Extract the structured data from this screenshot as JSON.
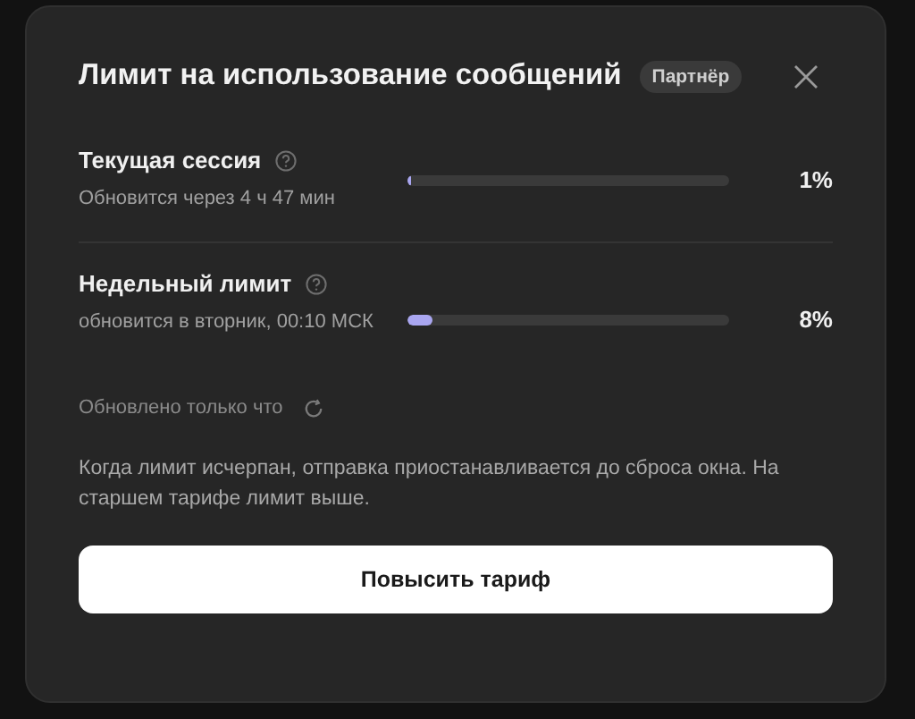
{
  "dialog": {
    "title": "Лимит на использование сообщений",
    "badge": "Партнёр",
    "limits": [
      {
        "name": "Текущая сессия",
        "reset": "Обновится через 4 ч 47 мин",
        "level": 0.01,
        "percent": "1%"
      },
      {
        "name": "Недельный лимит",
        "reset": "обновится в вторник, 00:10 МСК",
        "level": 0.08,
        "percent": "8%"
      }
    ],
    "updated": "Обновлено только что",
    "note": "Когда лимит исчерпан, отправка приостанавливается до сброса окна. На старшем тарифе лимит выше.",
    "button": "Повысить тариф"
  }
}
